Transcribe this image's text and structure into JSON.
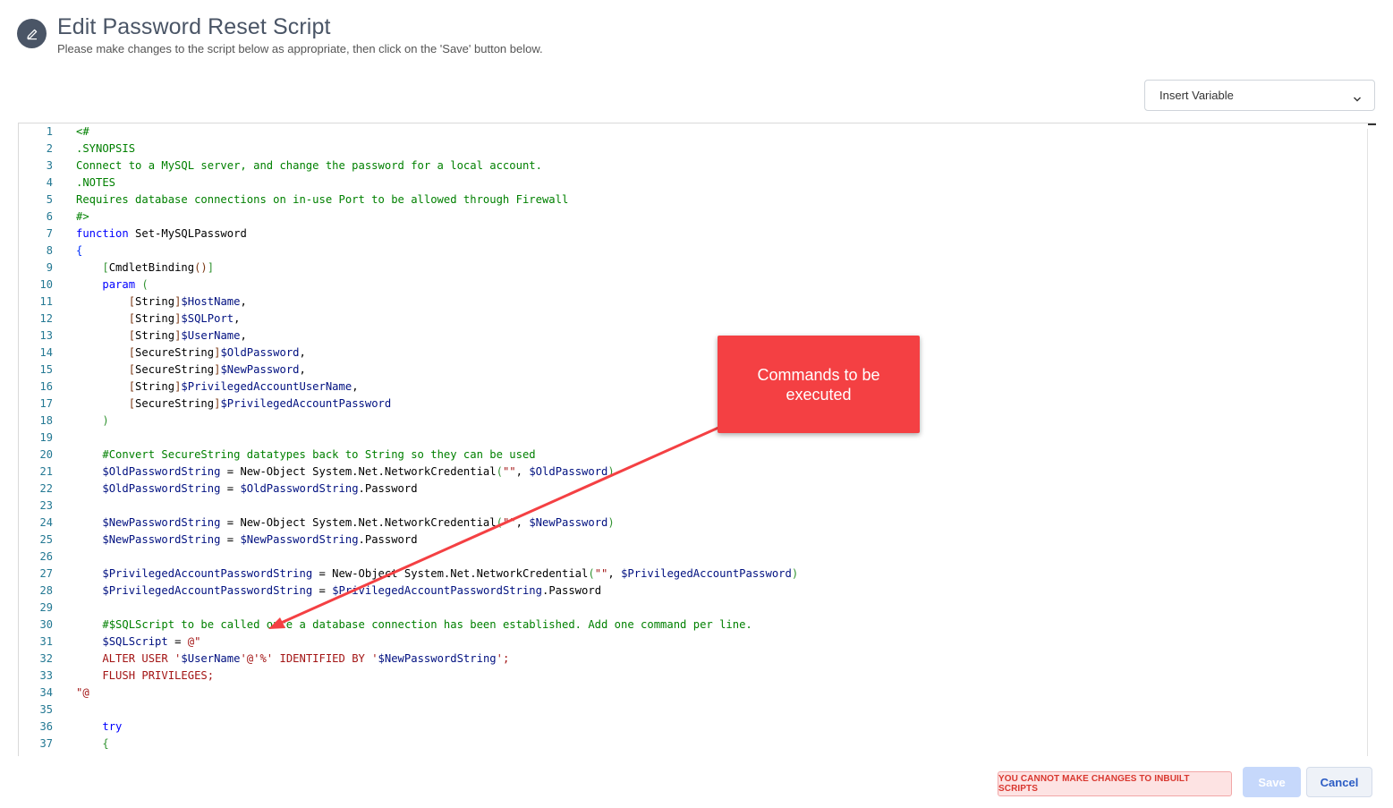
{
  "header": {
    "title": "Edit Password Reset Script",
    "subtitle": "Please make changes to the script below as appropriate, then click on the 'Save' button below.",
    "icon": "pencil-icon"
  },
  "insert_variable": {
    "label": "Insert Variable",
    "icon": "chevron-down-icon"
  },
  "editor": {
    "line_numbers": [
      "1",
      "2",
      "3",
      "4",
      "5",
      "6",
      "7",
      "8",
      "9",
      "10",
      "11",
      "12",
      "13",
      "14",
      "15",
      "16",
      "17",
      "18",
      "19",
      "20",
      "21",
      "22",
      "23",
      "24",
      "25",
      "26",
      "27",
      "28",
      "29",
      "30",
      "31",
      "32",
      "33",
      "34",
      "35",
      "36",
      "37"
    ],
    "lines": [
      [
        {
          "t": "<#",
          "c": "c"
        }
      ],
      [
        {
          "t": ".SYNOPSIS",
          "c": "c"
        }
      ],
      [
        {
          "t": "Connect to a MySQL server, and change the password for a local account.",
          "c": "c"
        }
      ],
      [
        {
          "t": ".NOTES",
          "c": "c"
        }
      ],
      [
        {
          "t": "Requires database connections on in-use Port to be allowed through Firewall",
          "c": "c"
        }
      ],
      [
        {
          "t": "#>",
          "c": "c"
        }
      ],
      [
        {
          "t": "function",
          "c": "k"
        },
        {
          "t": " Set-MySQLPassword",
          "c": "pl"
        }
      ],
      [
        {
          "t": "{",
          "c": "b1"
        }
      ],
      [
        {
          "t": "    ",
          "c": "pl"
        },
        {
          "t": "[",
          "c": "b2"
        },
        {
          "t": "CmdletBinding",
          "c": "pl"
        },
        {
          "t": "()",
          "c": "b3"
        },
        {
          "t": "]",
          "c": "b2"
        }
      ],
      [
        {
          "t": "    ",
          "c": "pl"
        },
        {
          "t": "param",
          "c": "k"
        },
        {
          "t": " ",
          "c": "pl"
        },
        {
          "t": "(",
          "c": "b2"
        }
      ],
      [
        {
          "t": "        ",
          "c": "pl"
        },
        {
          "t": "[",
          "c": "b3"
        },
        {
          "t": "String",
          "c": "pl"
        },
        {
          "t": "]",
          "c": "b3"
        },
        {
          "t": "$HostName",
          "c": "v"
        },
        {
          "t": ",",
          "c": "pl"
        }
      ],
      [
        {
          "t": "        ",
          "c": "pl"
        },
        {
          "t": "[",
          "c": "b3"
        },
        {
          "t": "String",
          "c": "pl"
        },
        {
          "t": "]",
          "c": "b3"
        },
        {
          "t": "$SQLPort",
          "c": "v"
        },
        {
          "t": ",",
          "c": "pl"
        }
      ],
      [
        {
          "t": "        ",
          "c": "pl"
        },
        {
          "t": "[",
          "c": "b3"
        },
        {
          "t": "String",
          "c": "pl"
        },
        {
          "t": "]",
          "c": "b3"
        },
        {
          "t": "$UserName",
          "c": "v"
        },
        {
          "t": ",",
          "c": "pl"
        }
      ],
      [
        {
          "t": "        ",
          "c": "pl"
        },
        {
          "t": "[",
          "c": "b3"
        },
        {
          "t": "SecureString",
          "c": "pl"
        },
        {
          "t": "]",
          "c": "b3"
        },
        {
          "t": "$OldPassword",
          "c": "v"
        },
        {
          "t": ",",
          "c": "pl"
        }
      ],
      [
        {
          "t": "        ",
          "c": "pl"
        },
        {
          "t": "[",
          "c": "b3"
        },
        {
          "t": "SecureString",
          "c": "pl"
        },
        {
          "t": "]",
          "c": "b3"
        },
        {
          "t": "$NewPassword",
          "c": "v"
        },
        {
          "t": ",",
          "c": "pl"
        }
      ],
      [
        {
          "t": "        ",
          "c": "pl"
        },
        {
          "t": "[",
          "c": "b3"
        },
        {
          "t": "String",
          "c": "pl"
        },
        {
          "t": "]",
          "c": "b3"
        },
        {
          "t": "$PrivilegedAccountUserName",
          "c": "v"
        },
        {
          "t": ",",
          "c": "pl"
        }
      ],
      [
        {
          "t": "        ",
          "c": "pl"
        },
        {
          "t": "[",
          "c": "b3"
        },
        {
          "t": "SecureString",
          "c": "pl"
        },
        {
          "t": "]",
          "c": "b3"
        },
        {
          "t": "$PrivilegedAccountPassword",
          "c": "v"
        }
      ],
      [
        {
          "t": "    ",
          "c": "pl"
        },
        {
          "t": ")",
          "c": "b2"
        }
      ],
      [],
      [
        {
          "t": "    ",
          "c": "pl"
        },
        {
          "t": "#Convert SecureString datatypes back to String so they can be used",
          "c": "c"
        }
      ],
      [
        {
          "t": "    ",
          "c": "pl"
        },
        {
          "t": "$OldPasswordString",
          "c": "v"
        },
        {
          "t": " = New-Object System.Net.NetworkCredential",
          "c": "pl"
        },
        {
          "t": "(",
          "c": "b2"
        },
        {
          "t": "\"\"",
          "c": "s"
        },
        {
          "t": ", ",
          "c": "pl"
        },
        {
          "t": "$OldPassword",
          "c": "v"
        },
        {
          "t": ")",
          "c": "b2"
        }
      ],
      [
        {
          "t": "    ",
          "c": "pl"
        },
        {
          "t": "$OldPasswordString",
          "c": "v"
        },
        {
          "t": " = ",
          "c": "pl"
        },
        {
          "t": "$OldPasswordString",
          "c": "v"
        },
        {
          "t": ".Password",
          "c": "pl"
        }
      ],
      [],
      [
        {
          "t": "    ",
          "c": "pl"
        },
        {
          "t": "$NewPasswordString",
          "c": "v"
        },
        {
          "t": " = New-Object System.Net.NetworkCredential",
          "c": "pl"
        },
        {
          "t": "(",
          "c": "b2"
        },
        {
          "t": "\"\"",
          "c": "s"
        },
        {
          "t": ", ",
          "c": "pl"
        },
        {
          "t": "$NewPassword",
          "c": "v"
        },
        {
          "t": ")",
          "c": "b2"
        }
      ],
      [
        {
          "t": "    ",
          "c": "pl"
        },
        {
          "t": "$NewPasswordString",
          "c": "v"
        },
        {
          "t": " = ",
          "c": "pl"
        },
        {
          "t": "$NewPasswordString",
          "c": "v"
        },
        {
          "t": ".Password",
          "c": "pl"
        }
      ],
      [],
      [
        {
          "t": "    ",
          "c": "pl"
        },
        {
          "t": "$PrivilegedAccountPasswordString",
          "c": "v"
        },
        {
          "t": " = New-Object System.Net.NetworkCredential",
          "c": "pl"
        },
        {
          "t": "(",
          "c": "b2"
        },
        {
          "t": "\"\"",
          "c": "s"
        },
        {
          "t": ", ",
          "c": "pl"
        },
        {
          "t": "$PrivilegedAccountPassword",
          "c": "v"
        },
        {
          "t": ")",
          "c": "b2"
        }
      ],
      [
        {
          "t": "    ",
          "c": "pl"
        },
        {
          "t": "$PrivilegedAccountPasswordString",
          "c": "v"
        },
        {
          "t": " = ",
          "c": "pl"
        },
        {
          "t": "$PrivilegedAccountPasswordString",
          "c": "v"
        },
        {
          "t": ".Password",
          "c": "pl"
        }
      ],
      [],
      [
        {
          "t": "    ",
          "c": "pl"
        },
        {
          "t": "#$SQLScript to be called once a database connection has been established. Add one command per line.",
          "c": "c"
        }
      ],
      [
        {
          "t": "    ",
          "c": "pl"
        },
        {
          "t": "$SQLScript",
          "c": "v"
        },
        {
          "t": " = ",
          "c": "pl"
        },
        {
          "t": "@\"",
          "c": "s"
        }
      ],
      [
        {
          "t": "    ALTER USER '",
          "c": "s"
        },
        {
          "t": "$UserName",
          "c": "v"
        },
        {
          "t": "'@'%' IDENTIFIED BY '",
          "c": "s"
        },
        {
          "t": "$NewPasswordString",
          "c": "v"
        },
        {
          "t": "';",
          "c": "s"
        }
      ],
      [
        {
          "t": "    FLUSH PRIVILEGES;",
          "c": "s"
        }
      ],
      [
        {
          "t": "\"@",
          "c": "s"
        }
      ],
      [],
      [
        {
          "t": "    ",
          "c": "pl"
        },
        {
          "t": "try",
          "c": "k"
        }
      ],
      [
        {
          "t": "    ",
          "c": "pl"
        },
        {
          "t": "{",
          "c": "b2"
        }
      ]
    ]
  },
  "callout": {
    "text": "Commands to be executed",
    "color": "#f44043"
  },
  "footer": {
    "warning": "YOU CANNOT MAKE CHANGES TO INBUILT SCRIPTS",
    "save_label": "Save",
    "cancel_label": "Cancel"
  }
}
